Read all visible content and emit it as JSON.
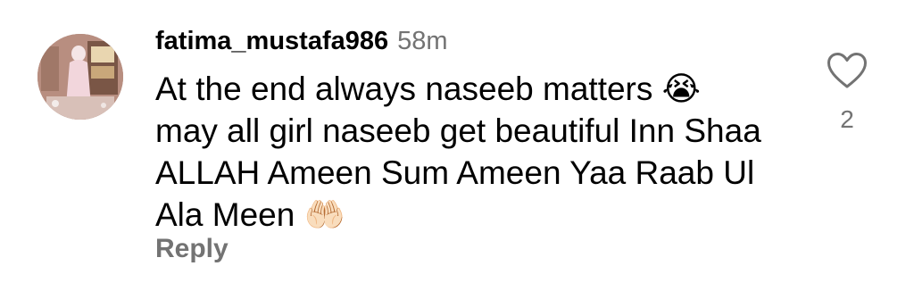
{
  "comment": {
    "username": "fatima_mustafa986",
    "timestamp": "58m",
    "text_part1": "At the end always naseeb matters ",
    "emoji_cry": "😭",
    "text_part2": "\nmay all girl naseeb get beautiful Inn Shaa\nALLAH Ameen Sum Ameen Yaa Raab Ul\nAla Meen ",
    "emoji_pray": "🤲🏻",
    "reply_label": "Reply",
    "like_count": "2",
    "avatar_icon": "profile-photo",
    "heart_icon": "heart-outline-icon"
  },
  "colors": {
    "text": "#000000",
    "secondary": "#737373",
    "background": "#ffffff"
  }
}
